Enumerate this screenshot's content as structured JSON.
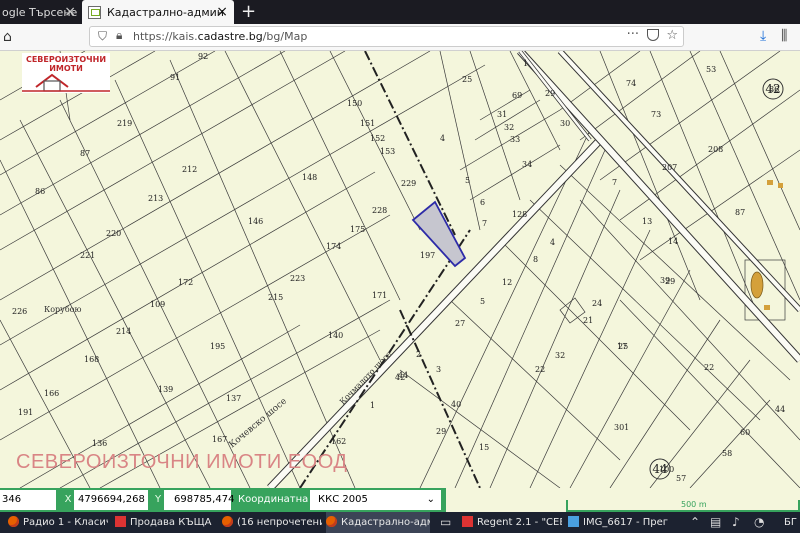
{
  "browser": {
    "tabs": [
      {
        "title": "ogle Търсене",
        "close": "×"
      },
      {
        "title": "Кадастрално-административна",
        "close": "×"
      }
    ],
    "new_tab": "+",
    "url_prefix": "https://kais.",
    "url_domain": "cadastre.bg",
    "url_path": "/bg/Map",
    "page_actions": "···"
  },
  "map": {
    "logo_text": "СЕВЕРОИЗТОЧНИ ИМОТИ",
    "watermark": "СЕВЕРОИЗТОЧНИ ИМОТИ ЕООД",
    "parcel_labels": [
      "92",
      "91",
      "25",
      "1",
      "69",
      "29",
      "31",
      "30",
      "32",
      "33",
      "34",
      "219",
      "150",
      "151",
      "152",
      "153",
      "4",
      "87",
      "212",
      "148",
      "229",
      "5",
      "6",
      "86",
      "213",
      "228",
      "7",
      "128",
      "175",
      "146",
      "220",
      "174",
      "197",
      "221",
      "223",
      "172",
      "215",
      "171",
      "226",
      "109",
      "214",
      "140",
      "195",
      "168",
      "139",
      "166",
      "137",
      "167",
      "191",
      "136",
      "162",
      "27",
      "3",
      "2",
      "1",
      "29",
      "40",
      "15",
      "16",
      "32",
      "22",
      "21",
      "12",
      "5",
      "4",
      "8",
      "7",
      "13",
      "14",
      "39",
      "17",
      "29",
      "25",
      "24",
      "22",
      "44",
      "60",
      "58",
      "57",
      "54",
      "53",
      "74",
      "73",
      "208",
      "207",
      "87",
      "86",
      "100",
      "42",
      "44",
      "301",
      "30",
      "12"
    ],
    "place_names": [
      "Корубою"
    ],
    "road_names": [
      "Кочмалото шосе",
      "Кочевско шосе"
    ],
    "circled_numbers": [
      "42",
      "44"
    ],
    "selected_parcel": "197",
    "selection_color": "#c6c6cf",
    "selection_border": "#2d2ba8",
    "scale_label": "500 m"
  },
  "coordinates": {
    "prefix_value": "346",
    "x_label": "X",
    "x_value": "4796694,268",
    "y_label": "Y",
    "y_value": "698785,474",
    "system_label": "Координатна система",
    "system_value": "ККС 2005",
    "system_chevron": "⌄"
  },
  "taskbar": {
    "items": [
      "Радио 1 - Класичес...",
      "Продава КЪЩА в г...",
      "(16 непрочетени) - ...",
      "Кадастрално-адми...",
      "Regent 2.1 - \"СЕВЕР...",
      "IMG_6617 - Прегле...",
      "БГ"
    ]
  }
}
